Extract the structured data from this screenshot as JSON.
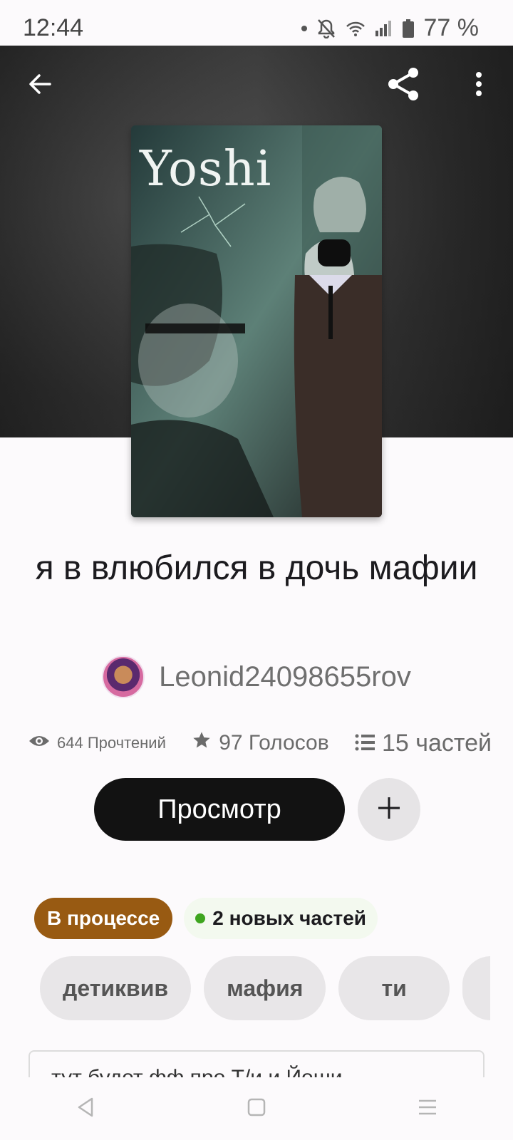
{
  "status_bar": {
    "time": "12:44",
    "battery": "77 %",
    "icons": [
      "notification-dot-icon",
      "mute-bell-icon",
      "wifi-icon",
      "signal-icon",
      "battery-icon"
    ]
  },
  "header": {
    "back_icon": "arrow-left-icon",
    "share_icon": "share-icon",
    "menu_icon": "more-vertical-icon"
  },
  "cover": {
    "title_text": "Yoshi"
  },
  "book": {
    "title": "я в влюбился в дочь мафии",
    "author": "Leonid24098655rov"
  },
  "stats": {
    "reads": "644 Прочтений",
    "votes": "97 Голосов",
    "parts": "15 частей"
  },
  "actions": {
    "read_label": "Просмотр",
    "add_icon": "plus-icon"
  },
  "badges": {
    "status": "В процессе",
    "new_parts": "2 новых частей"
  },
  "tags": [
    "детиквив",
    "мафия",
    "ти",
    ""
  ],
  "description": {
    "text": "тут будет фф про Т/и и Йоши"
  },
  "colors": {
    "status_badge": "#985a12",
    "new_dot": "#3ea51f",
    "primary_button": "#121212"
  }
}
